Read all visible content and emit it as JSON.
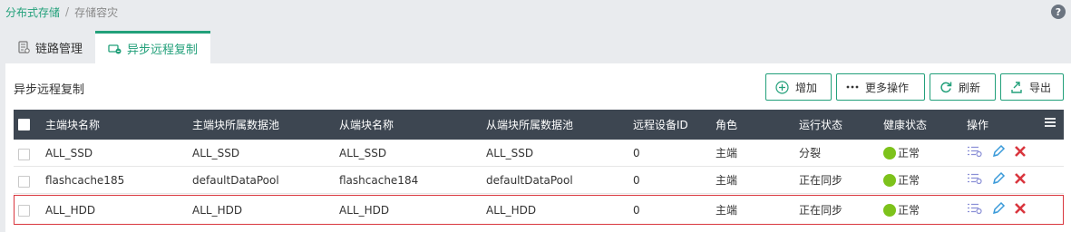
{
  "breadcrumb": {
    "root": "分布式存储",
    "separator": "/",
    "current": "存储容灾"
  },
  "tabs": [
    {
      "label": "链路管理"
    },
    {
      "label": "异步远程复制"
    }
  ],
  "panel": {
    "title": "异步远程复制"
  },
  "toolbar": {
    "add": "增加",
    "more": "更多操作",
    "refresh": "刷新",
    "export": "导出"
  },
  "table": {
    "headers": [
      "主端块名称",
      "主端块所属数据池",
      "从端块名称",
      "从端块所属数据池",
      "远程设备ID",
      "角色",
      "运行状态",
      "健康状态",
      "操作"
    ],
    "rows": [
      {
        "primary": "ALL_SSD",
        "primary_pool": "ALL_SSD",
        "secondary": "ALL_SSD",
        "secondary_pool": "ALL_SSD",
        "remote_id": "0",
        "role": "主端",
        "run_state": "分裂",
        "health": "正常"
      },
      {
        "primary": "flashcache185",
        "primary_pool": "defaultDataPool",
        "secondary": "flashcache184",
        "secondary_pool": "defaultDataPool",
        "remote_id": "0",
        "role": "主端",
        "run_state": "正在同步",
        "health": "正常"
      },
      {
        "primary": "ALL_HDD",
        "primary_pool": "ALL_HDD",
        "secondary": "ALL_HDD",
        "secondary_pool": "ALL_HDD",
        "remote_id": "0",
        "role": "主端",
        "run_state": "正在同步",
        "health": "正常"
      }
    ]
  },
  "colors": {
    "accent": "#22a07a",
    "header_bg": "#3d4651",
    "health_ok": "#7dc21b",
    "delete": "#d9363e",
    "edit": "#3a9ad9",
    "selection_border": "#d9363e"
  },
  "icons": {
    "help": "help-icon",
    "link_mgmt": "link-management-icon",
    "replication": "replication-icon",
    "add": "plus-circle-icon",
    "more": "ellipsis-icon",
    "refresh": "refresh-icon",
    "export": "export-icon",
    "columns": "column-menu-icon",
    "detail": "detail-list-icon",
    "edit": "pencil-icon",
    "delete": "delete-x-icon"
  }
}
